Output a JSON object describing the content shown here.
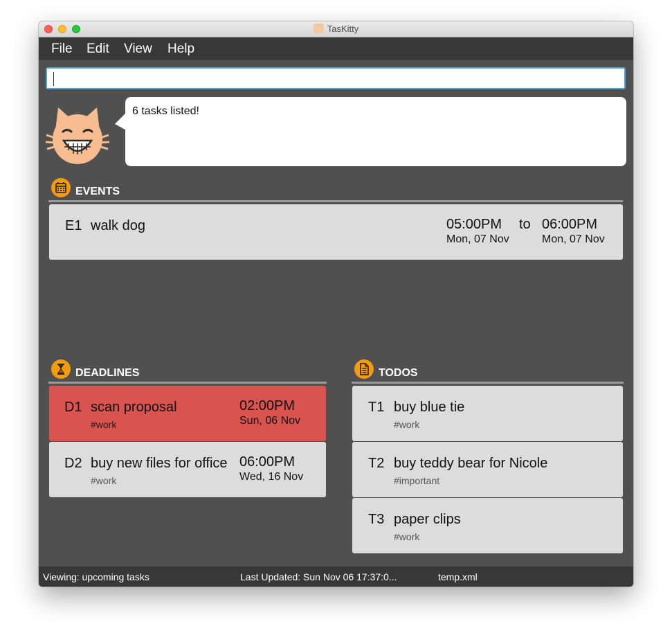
{
  "window": {
    "title": "TasKitty"
  },
  "menu": {
    "items": [
      "File",
      "Edit",
      "View",
      "Help"
    ]
  },
  "command": {
    "value": ""
  },
  "feedback": {
    "text": "6 tasks listed!"
  },
  "events": {
    "title": "EVENTS",
    "items": [
      {
        "index": "E1",
        "name": "walk dog",
        "start_time": "05:00PM",
        "start_date": "Mon, 07 Nov",
        "to_label": "to",
        "end_time": "06:00PM",
        "end_date": "Mon, 07 Nov"
      }
    ]
  },
  "deadlines": {
    "title": "DEADLINES",
    "items": [
      {
        "index": "D1",
        "name": "scan proposal",
        "tag": "#work",
        "time": "02:00PM",
        "date": "Sun, 06 Nov",
        "overdue": true
      },
      {
        "index": "D2",
        "name": "buy new files for office",
        "tag": "#work",
        "time": "06:00PM",
        "date": "Wed, 16 Nov",
        "overdue": false
      }
    ]
  },
  "todos": {
    "title": "TODOS",
    "items": [
      {
        "index": "T1",
        "name": "buy blue tie",
        "tag": "#work"
      },
      {
        "index": "T2",
        "name": "buy teddy bear for Nicole",
        "tag": "#important"
      },
      {
        "index": "T3",
        "name": "paper clips",
        "tag": "#work"
      }
    ]
  },
  "status": {
    "viewing": "Viewing: upcoming tasks",
    "last_updated": "Last Updated: Sun Nov 06 17:37:0...",
    "file": "temp.xml"
  },
  "colors": {
    "overdue": "#d9534f",
    "accent": "#f39c12",
    "panel": "#505050",
    "card": "#dcdcdc"
  },
  "icons": {
    "events": "calendar-icon",
    "deadlines": "hourglass-icon",
    "todos": "document-icon",
    "mascot": "cat-icon"
  }
}
